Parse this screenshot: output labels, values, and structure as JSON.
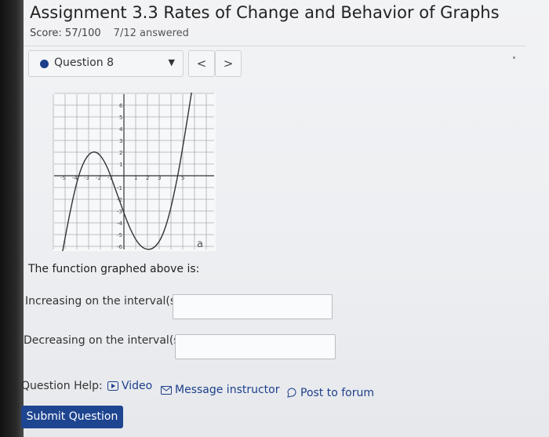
{
  "header": {
    "title": "Assignment 3.3 Rates of Change and Behavior of Graphs",
    "score": "Score: 57/100",
    "answered": "7/12 answered"
  },
  "question_nav": {
    "label": "Question 8",
    "prev": "<",
    "next": ">"
  },
  "graph": {
    "x_ticks": [
      "-5",
      "-4",
      "-3",
      "-2",
      "-1",
      "1",
      "2",
      "3",
      "5"
    ],
    "y_ticks": [
      "6",
      "5",
      "4",
      "3",
      "2",
      "1",
      "-1",
      "-2",
      "-3",
      "-4",
      "-5",
      "-6"
    ],
    "curve_label": "a"
  },
  "body": {
    "prompt": "The function graphed above is:",
    "increasing_label": "Increasing on the interval(s)",
    "increasing_value": "",
    "decreasing_label": "Decreasing on the interval(s)",
    "decreasing_value": ""
  },
  "help": {
    "label": "Question Help:",
    "video": "Video",
    "message": "Message instructor",
    "forum": "Post to forum"
  },
  "submit_label": "Submit Question",
  "colors": {
    "accent": "#1e4590",
    "dot": "#1d3f8a"
  }
}
